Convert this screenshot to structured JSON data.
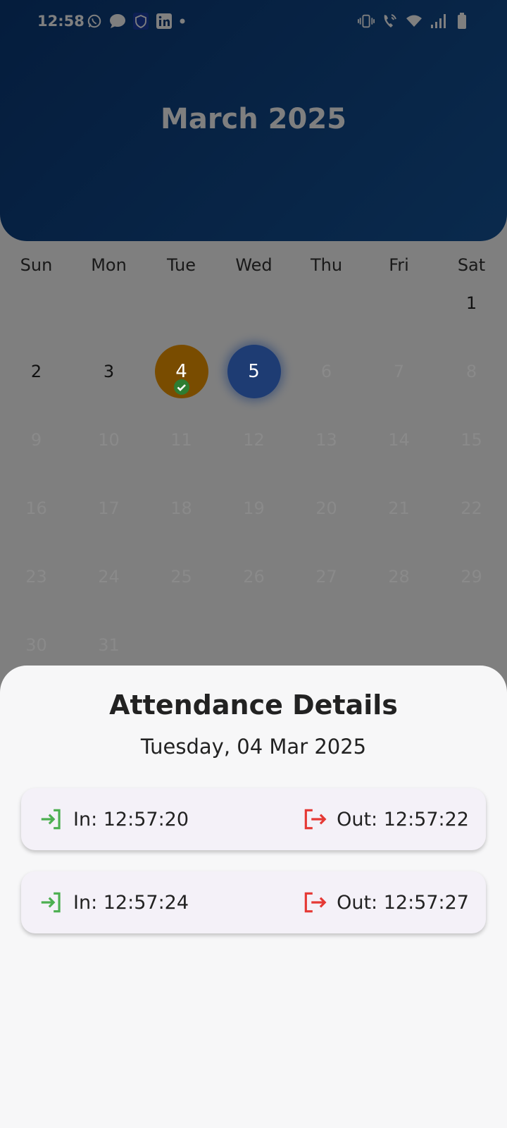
{
  "status_bar": {
    "time": "12:58",
    "left_icons": [
      "whatsapp-icon",
      "message-icon",
      "shield-app-icon",
      "linkedin-icon",
      "dot-icon"
    ],
    "right_icons": [
      "vibrate-icon",
      "wifi-calling-icon",
      "wifi-icon",
      "signal-icon",
      "battery-icon"
    ]
  },
  "header": {
    "title": "March 2025"
  },
  "calendar": {
    "weekdays": [
      "Sun",
      "Mon",
      "Tue",
      "Wed",
      "Thu",
      "Fri",
      "Sat"
    ],
    "weeks": [
      [
        "",
        "",
        "",
        "",
        "",
        "",
        "1"
      ],
      [
        "2",
        "3",
        "4",
        "5",
        "6",
        "7",
        "8"
      ],
      [
        "9",
        "10",
        "11",
        "12",
        "13",
        "14",
        "15"
      ],
      [
        "16",
        "17",
        "18",
        "19",
        "20",
        "21",
        "22"
      ],
      [
        "23",
        "24",
        "25",
        "26",
        "27",
        "28",
        "29"
      ],
      [
        "30",
        "31",
        "",
        "",
        "",
        "",
        ""
      ]
    ],
    "attended_day": "4",
    "today": "5",
    "attended_color": "#f29800",
    "today_color": "#3d79e6",
    "check_color": "#2e7d32"
  },
  "sheet": {
    "title": "Attendance Details",
    "date": "Tuesday, 04 Mar 2025",
    "records": [
      {
        "in": "In: 12:57:20",
        "out": "Out: 12:57:22"
      },
      {
        "in": "In: 12:57:24",
        "out": "Out: 12:57:27"
      }
    ],
    "in_icon_color": "#4caf50",
    "out_icon_color": "#e53935"
  }
}
